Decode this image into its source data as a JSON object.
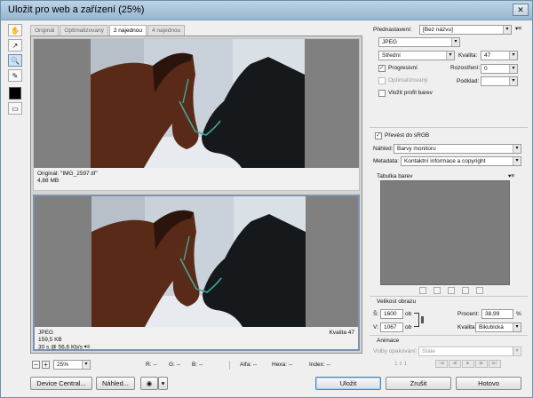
{
  "window": {
    "title": "Uložit pro web a zařízení (25%)"
  },
  "tools": [
    "hand-icon",
    "slice-select-icon",
    "zoom-icon",
    "eyedropper-icon",
    "color-swatch",
    "toggle-slices-icon"
  ],
  "tabs": [
    {
      "label": "Originál",
      "active": false
    },
    {
      "label": "Optimalizovaný",
      "active": false
    },
    {
      "label": "2 najednou",
      "active": true
    },
    {
      "label": "4 najednou",
      "active": false
    }
  ],
  "original": {
    "name": "Originál: \"IMG_2597.tif\"",
    "size": "4,88 MB"
  },
  "optimized": {
    "format": "JPEG",
    "size": "159,5 KB",
    "time": "30 s @ 56,6 Kb/s",
    "quality": "Kvalita 47"
  },
  "settings": {
    "preset_label": "Přednastavení:",
    "preset_value": "[Bez názvu]",
    "format": "JPEG",
    "quality_level": "Střední",
    "quality_label": "Kvalita:",
    "quality_value": "47",
    "blur_label": "Rozostření:",
    "blur_value": "0",
    "matte_label": "Podklad:",
    "progressive": "Progresivní",
    "optimized": "Optimalizovaný",
    "embed_profile": "Vložit profil barev",
    "convert_srgb": "Převést do sRGB",
    "preview_label": "Náhled:",
    "preview_value": "Barvy monitoru",
    "metadata_label": "Metadata:",
    "metadata_value": "Kontaktní informace a copyright",
    "color_table": "Tabulka barev"
  },
  "image_size": {
    "heading": "Velikost obrazu",
    "w_label": "Š:",
    "w_value": "1600",
    "h_label": "V:",
    "h_value": "1067",
    "unit": "ob",
    "percent_label": "Procent:",
    "percent_value": "38,99",
    "percent_unit": "%",
    "quality_label": "Kvalita:",
    "quality_value": "Bikubická"
  },
  "animation": {
    "heading": "Animace",
    "loop_label": "Volby opakování:",
    "loop_value": "Stále",
    "frame": "1 z 1"
  },
  "statusbar": {
    "zoom": "25%",
    "r": "R: --",
    "g": "G: --",
    "b": "B: --",
    "alpha": "Alfa: --",
    "hex": "Hexa: --",
    "index": "Index: --"
  },
  "buttons": {
    "device_central": "Device Central...",
    "preview": "Náhled...",
    "save": "Uložit",
    "cancel": "Zrušit",
    "done": "Hotovo"
  },
  "colors": {
    "accent": "#4c84c2",
    "title_bar": "#a9c4da",
    "panel": "#efefef",
    "matte": "#808080"
  }
}
